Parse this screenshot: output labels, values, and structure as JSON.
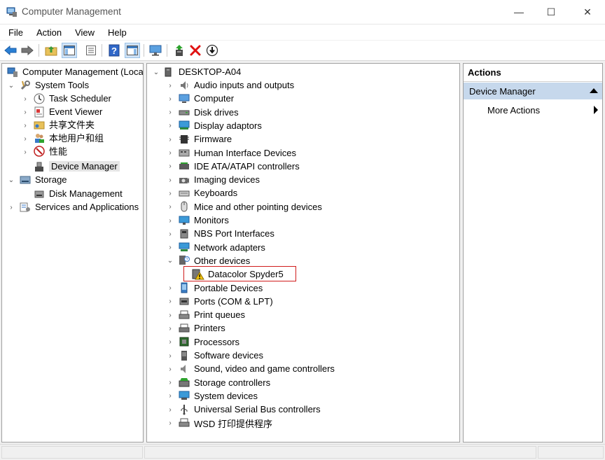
{
  "window": {
    "title": "Computer Management",
    "minimize_glyph": "—",
    "maximize_glyph": "☐",
    "close_glyph": "✕"
  },
  "menu": [
    "File",
    "Action",
    "View",
    "Help"
  ],
  "toolbar_icons": [
    "back-arrow-icon",
    "forward-arrow-icon",
    "up-folder-icon",
    "show-hide-tree-icon",
    "properties-icon",
    "help-icon",
    "show-hide-action-pane-icon",
    "monitor-icon",
    "update-driver-icon",
    "uninstall-icon",
    "download-icon"
  ],
  "left_tree": {
    "root": "Computer Management (Local)",
    "system_tools": "System Tools",
    "task_scheduler": "Task Scheduler",
    "event_viewer": "Event Viewer",
    "shared_folders": "共享文件夹",
    "local_users": "本地用户和组",
    "performance": "性能",
    "device_manager": "Device Manager",
    "storage": "Storage",
    "disk_management": "Disk Management",
    "services_apps": "Services and Applications"
  },
  "device_tree": {
    "computer_name": "DESKTOP-A04",
    "categories": [
      "Audio inputs and outputs",
      "Computer",
      "Disk drives",
      "Display adaptors",
      "Firmware",
      "Human Interface Devices",
      "IDE ATA/ATAPI controllers",
      "Imaging devices",
      "Keyboards",
      "Mice and other pointing devices",
      "Monitors",
      "NBS Port Interfaces",
      "Network adapters",
      "Other devices",
      "Portable Devices",
      "Ports (COM & LPT)",
      "Print queues",
      "Printers",
      "Processors",
      "Software devices",
      "Sound, video and game controllers",
      "Storage controllers",
      "System devices",
      "Universal Serial Bus controllers",
      "WSD 打印提供程序"
    ],
    "other_device_child": "Datacolor Spyder5"
  },
  "actions": {
    "header": "Actions",
    "section": "Device Manager",
    "more": "More Actions"
  },
  "colors": {
    "selection_bg": "#e5e5e5",
    "actions_section_bg": "#c6d8ec",
    "highlight_border": "#d01c1c",
    "remove_red": "#e01010"
  }
}
